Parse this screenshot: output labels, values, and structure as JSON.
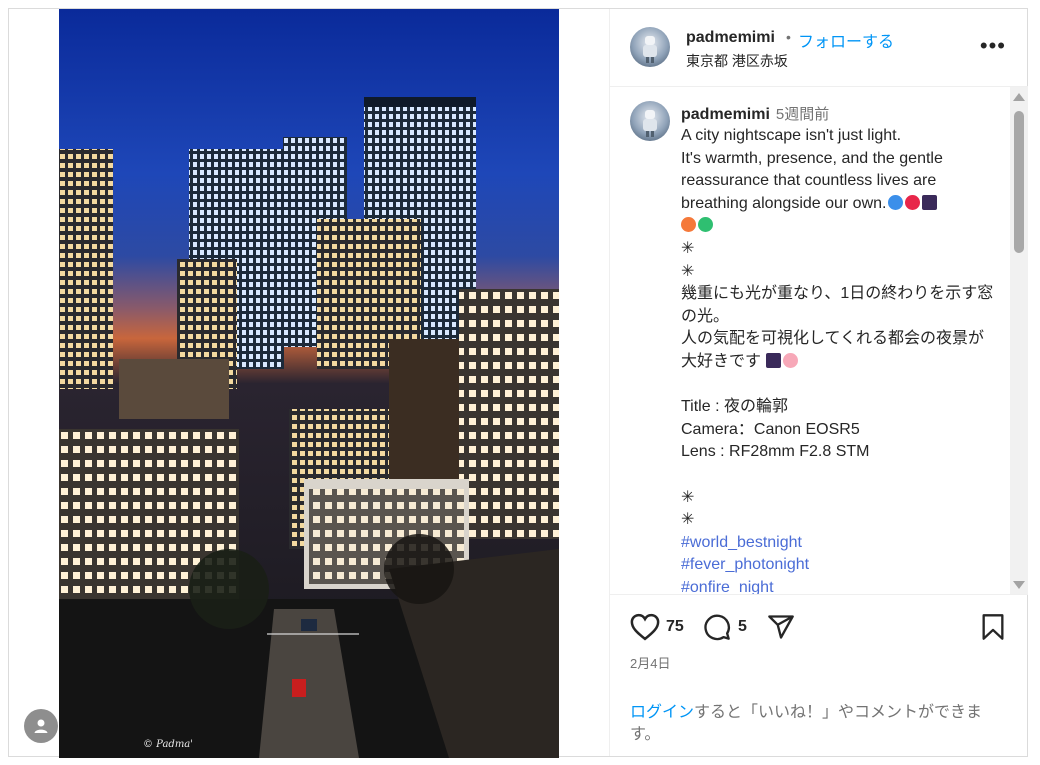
{
  "post": {
    "image_watermark": "© Padma'"
  },
  "header": {
    "username": "padmemimi",
    "separator": "•",
    "follow_label": "フォローする",
    "location": "東京都 港区赤坂",
    "more_label": "•••",
    "more_icon": "more-dots-icon"
  },
  "caption": {
    "username": "padmemimi",
    "time": "5週間前",
    "lines": [
      "A city nightscape isn't just light.",
      "It's warmth, presence, and the gentle reassurance that countless lives are breathing alongside our own."
    ],
    "sparkle1": "✳",
    "sparkle2": "✳",
    "jp_line1": "幾重にも光が重なり、1日の終わりを示す窓の光。",
    "jp_line2": "人の気配を可視化してくれる都会の夜景が大好きです",
    "title_line": "Title : 夜の輪郭",
    "camera_line": "Camera：Canon EOSR5",
    "lens_line": "Lens : RF28mm F2.8 STM",
    "sparkle3": "✳",
    "sparkle4": "✳",
    "hashtags": [
      "#world_bestnight",
      "#fever_photonight",
      "#onfire_night"
    ]
  },
  "actions": {
    "like_count": "75",
    "comment_count": "5",
    "like_icon": "heart-icon",
    "comment_icon": "comment-icon",
    "share_icon": "share-icon",
    "save_icon": "bookmark-icon"
  },
  "date": "2月4日",
  "login_prompt": {
    "link": "ログイン",
    "rest": "すると「いいね！」やコメントができます。"
  },
  "colors": {
    "follow_blue": "#0095f6",
    "hashtag_blue": "#4a6cd6",
    "muted": "#737373"
  }
}
